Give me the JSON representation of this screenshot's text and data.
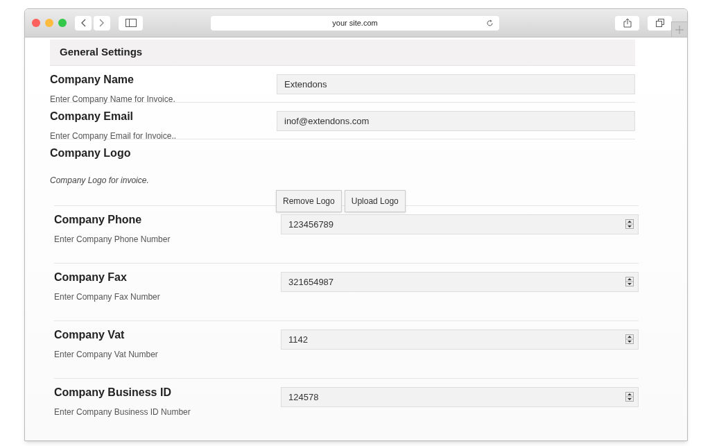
{
  "browser": {
    "address": "your site.com"
  },
  "header": {
    "title": "General Settings"
  },
  "fields": [
    {
      "kind": "text",
      "label": "Company Name",
      "description": "Enter Company Name for Invoice.",
      "value": "Extendons"
    },
    {
      "kind": "text",
      "label": "Company Email",
      "description": "Enter Company Email for Invoice..",
      "value": "inof@extendons.com"
    },
    {
      "kind": "logo",
      "label": "Company Logo",
      "description": "Company Logo for invoice.",
      "buttons": [
        "Remove Logo",
        "Upload Logo"
      ]
    },
    {
      "kind": "number",
      "label": "Company Phone",
      "description": "Enter Company Phone Number",
      "value": "123456789"
    },
    {
      "kind": "number",
      "label": "Company Fax",
      "description": "Enter Company Fax Number",
      "value": "321654987"
    },
    {
      "kind": "number",
      "label": "Company Vat",
      "description": "Enter Company Vat Number",
      "value": "1142"
    },
    {
      "kind": "number",
      "label": "Company Business ID",
      "description": "Enter Company Business ID Number",
      "value": "124578"
    }
  ]
}
